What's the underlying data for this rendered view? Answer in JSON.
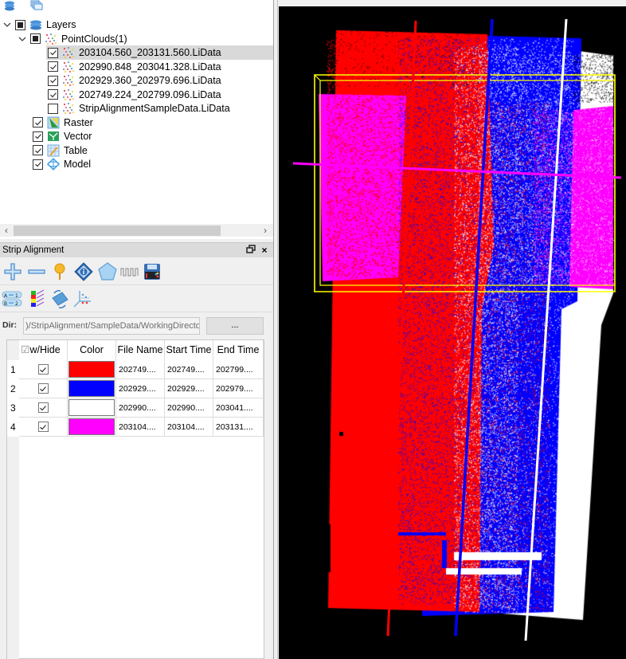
{
  "layers_panel": {
    "toolbar_icons": [
      "layers-stack-icon",
      "multi-window-icon"
    ],
    "tree": [
      {
        "label": "Layers",
        "level": 0,
        "expanded": true,
        "check": "partial",
        "icon": "layers-icon"
      },
      {
        "label": "PointClouds(1)",
        "level": 1,
        "expanded": true,
        "check": "partial",
        "icon": "pointcloud-icon"
      },
      {
        "label": "203104.560_203131.560.LiData",
        "level": 2,
        "check": "checked",
        "icon": "pointcloud-icon",
        "selected": true
      },
      {
        "label": "202990.848_203041.328.LiData",
        "level": 2,
        "check": "checked",
        "icon": "pointcloud-icon"
      },
      {
        "label": "202929.360_202979.696.LiData",
        "level": 2,
        "check": "checked",
        "icon": "pointcloud-icon"
      },
      {
        "label": "202749.224_202799.096.LiData",
        "level": 2,
        "check": "checked",
        "icon": "pointcloud-icon"
      },
      {
        "label": "StripAlignmentSampleData.LiData",
        "level": 2,
        "check": "unchecked",
        "icon": "pointcloud-icon"
      },
      {
        "label": "Raster",
        "level": 1,
        "check": "checked",
        "icon": "raster-icon"
      },
      {
        "label": "Vector",
        "level": 1,
        "check": "checked",
        "icon": "vector-icon"
      },
      {
        "label": "Table",
        "level": 1,
        "check": "checked",
        "icon": "table-icon"
      },
      {
        "label": "Model",
        "level": 1,
        "check": "checked",
        "icon": "model-icon"
      }
    ]
  },
  "strip_panel": {
    "title": "Strip Alignment",
    "toolbar_row1": [
      "add-icon",
      "remove-icon",
      "pin-icon",
      "info-icon",
      "pentagon-icon",
      "waveform-icon",
      "save-icon"
    ],
    "toolbar_row2": [
      "ab-mapping-icon",
      "color-bands-icon",
      "rotate-strip-icon",
      "axis-plot-icon"
    ],
    "dir_label": "Dir:",
    "dir_value": ")/StripAlignment/SampleData/WorkingDirectory/",
    "browse_label": "...",
    "table": {
      "headers": [
        "Show/Hide",
        "Color",
        "File Name",
        "Start Time",
        "End Time"
      ],
      "header_visible_text": "w/Hide",
      "rows": [
        {
          "num": "1",
          "shown": true,
          "color": "#ff0000",
          "file": "202749....",
          "start": "202749....",
          "end": "202799...."
        },
        {
          "num": "2",
          "shown": true,
          "color": "#0000ff",
          "file": "202929....",
          "start": "202929....",
          "end": "202979...."
        },
        {
          "num": "3",
          "shown": true,
          "color": "#ffffff",
          "file": "202990....",
          "start": "202990....",
          "end": "203041...."
        },
        {
          "num": "4",
          "shown": true,
          "color": "#ff00ff",
          "file": "203104....",
          "start": "203104....",
          "end": "203131...."
        }
      ]
    }
  },
  "viewport": {
    "background": "#000000",
    "strip_colors": [
      "#ff0000",
      "#0000ff",
      "#ffffff",
      "#ff00ff"
    ],
    "bbox_color": "#ffff00"
  }
}
